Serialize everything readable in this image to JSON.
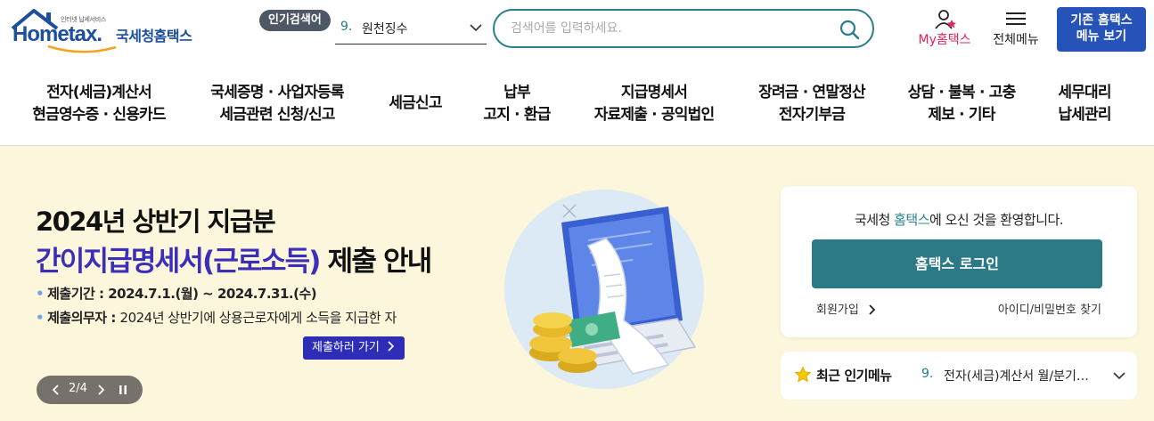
{
  "header": {
    "logo": {
      "tagline": "인터넷 납세서비스",
      "wordmark": "Hometax.",
      "subtitle": "국세청홈택스"
    },
    "popular_search": {
      "badge": "인기검색어",
      "rank": "9.",
      "term": "원천징수"
    },
    "search": {
      "placeholder": "검색어를 입력하세요.",
      "value": ""
    },
    "my_hometax_label": "My홈택스",
    "all_menu_label": "전체메뉴",
    "legacy_button": {
      "line1": "기존 홈택스",
      "line2": "메뉴 보기"
    }
  },
  "gnb": [
    {
      "line1": "전자(세금)계산서",
      "line2": "현금영수증 · 신용카드"
    },
    {
      "line1": "국세증명 · 사업자등록",
      "line2": "세금관련 신청/신고"
    },
    {
      "line1": "세금신고",
      "line2": ""
    },
    {
      "line1": "납부",
      "line2": "고지 · 환급"
    },
    {
      "line1": "지급명세서",
      "line2": "자료제출 · 공익법인"
    },
    {
      "line1": "장려금 · 연말정산",
      "line2": "전자기부금"
    },
    {
      "line1": "상담 · 불복 · 고충",
      "line2": "제보 · 기타"
    },
    {
      "line1": "세무대리",
      "line2": "납세관리"
    }
  ],
  "banner": {
    "title_line1": "2024년 상반기 지급분",
    "title_highlight": "간이지급명세서(근로소득)",
    "title_rest": " 제출 안내",
    "bullet1_key": "제출기간 : 2024.7.1.(월) ~ 2024.7.31.(수)",
    "bullet2_key": "제출의무자 : ",
    "bullet2_value": "2024년 상반기에 상용근로자에게 소득을 지급한 자",
    "cta": "제출하러 가기",
    "pager": {
      "current": "2",
      "separator": "/",
      "total": "4"
    }
  },
  "login_card": {
    "welcome_prefix": "국세청 ",
    "welcome_brand": "홈택스",
    "welcome_suffix": "에 오신 것을 환영합니다.",
    "login_button": "홈택스 로그인",
    "join_label": "회원가입",
    "find_label": "아이디/비밀번호 찾기"
  },
  "recent_menu": {
    "title": "최근 인기메뉴",
    "rank": "9.",
    "item": "전자(세금)계산서 월/분기별 합계 조회"
  },
  "colors": {
    "brand_blue": "#1c4f9c",
    "teal": "#2b7a86",
    "banner_bg": "#fbf6dc",
    "cta_purple": "#2e2db8",
    "my_hometax_pink": "#e0245e",
    "legacy_blue": "#2653b8"
  }
}
